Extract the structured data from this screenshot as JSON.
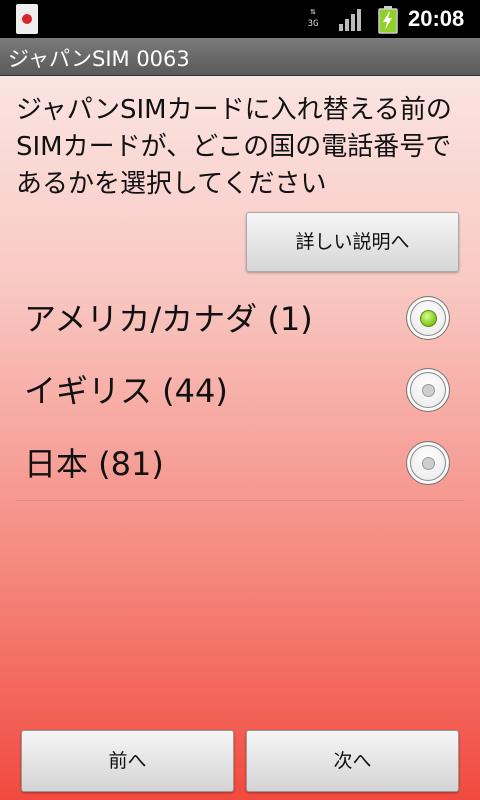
{
  "status_bar": {
    "network": "3G",
    "time": "20:08",
    "notification_icon": "app-notification-icon",
    "signal_icon": "signal-icon",
    "battery_icon": "battery-charging-icon"
  },
  "title_bar": {
    "title": "ジャパンSIM 0063"
  },
  "instruction": "ジャパンSIMカードに入れ替える前のSIMカードが、どこの国の電話番号であるかを選択してください",
  "detail_button": "詳しい説明へ",
  "options": [
    {
      "label": "アメリカ/カナダ (1)",
      "checked": true
    },
    {
      "label": "イギリス (44)",
      "checked": false
    },
    {
      "label": "日本 (81)",
      "checked": false
    }
  ],
  "buttons": {
    "prev": "前へ",
    "next": "次へ"
  }
}
